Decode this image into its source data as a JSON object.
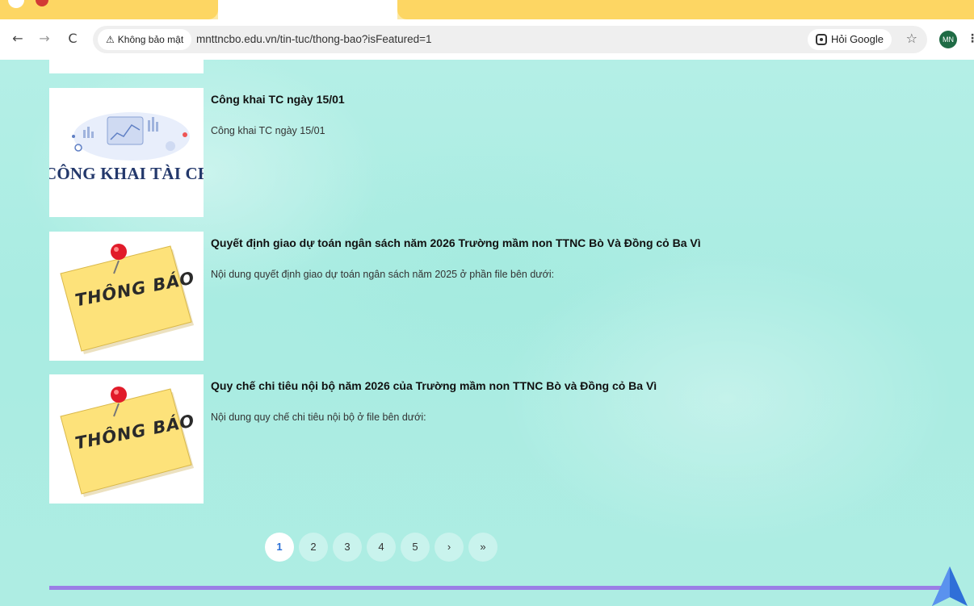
{
  "browser": {
    "back_icon": "arrow-left-icon",
    "forward_icon": "arrow-right-icon",
    "reload_icon": "reload-icon",
    "security_label": "Không bảo mật",
    "url": "mnttncbo.edu.vn/tin-tuc/thong-bao?isFeatured=1",
    "google_chip_label": "Hỏi Google",
    "avatar_initials": "MN"
  },
  "news": [
    {
      "title": "Công khai TC ngày 15/01",
      "description": "Công khai TC ngày 15/01",
      "thumbnail_caption": "CÔNG KHAI TÀI CHÍNH"
    },
    {
      "title": "Quyết định giao dự toán ngân sách năm 2026 Trường mầm non TTNC Bò Và Đồng cỏ Ba Vì",
      "description": "Nội dung quyết định giao dự toán ngân sách năm 2025 ở phần file bên dưới:",
      "thumbnail_caption": "THÔNG BÁO"
    },
    {
      "title": "Quy chế chi tiêu nội bộ năm 2026 của Trường mầm non TTNC Bò và Đồng cỏ Ba Vì",
      "description": "Nội dung quy chế chi tiêu nội bộ ở file bên dưới:",
      "thumbnail_caption": "THÔNG BÁO"
    }
  ],
  "pagination": {
    "pages": [
      "1",
      "2",
      "3",
      "4",
      "5"
    ],
    "next": "›",
    "last": "»",
    "current": "1"
  },
  "colors": {
    "page_background": "#aeede3",
    "footer_line": "#9b7ee6",
    "active_page": "#2a6fd6",
    "tab_yellow": "#fdd663"
  }
}
